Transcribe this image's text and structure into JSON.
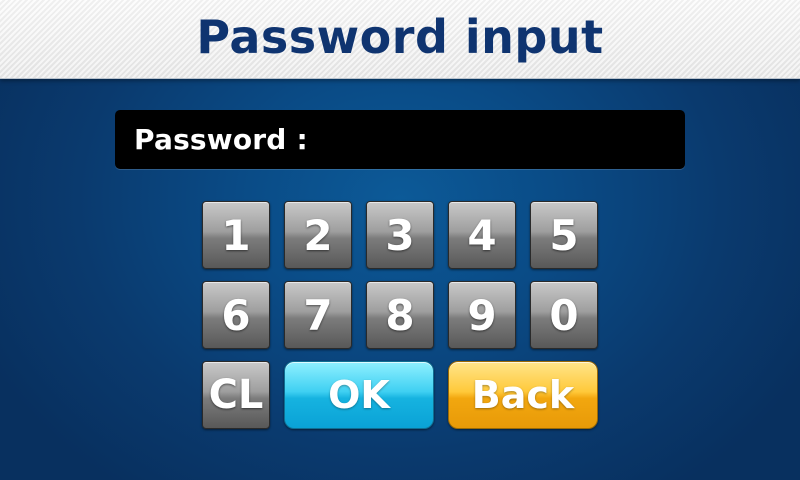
{
  "header": {
    "title": "Password input"
  },
  "password_field": {
    "label": "Password :",
    "value": ""
  },
  "keypad": {
    "keys": [
      "1",
      "2",
      "3",
      "4",
      "5",
      "6",
      "7",
      "8",
      "9",
      "0"
    ],
    "clear_label": "CL",
    "ok_label": "OK",
    "back_label": "Back"
  },
  "colors": {
    "title": "#0f3470",
    "background": "#0a4b86",
    "ok": "#16b3e0",
    "back": "#f2a70f",
    "key": "#8a8a8a"
  }
}
